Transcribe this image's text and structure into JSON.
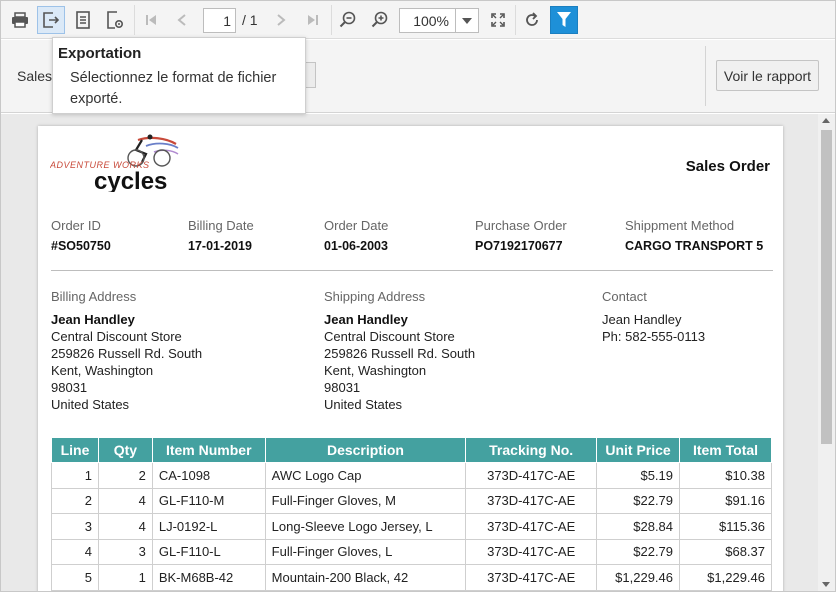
{
  "toolbar": {
    "page_current": "1",
    "page_total": "/ 1",
    "zoom": "100%"
  },
  "tooltip": {
    "title": "Exportation",
    "body": "Sélectionnez le format de fichier exporté."
  },
  "params": {
    "label": "Sales",
    "view_button": "Voir le rapport"
  },
  "colors": {
    "accent": "#1e90d8",
    "table_header": "#44a1a0"
  },
  "report": {
    "logo_text_top": "ADVENTURE WORKS",
    "logo_text_bottom": "cycles",
    "title": "Sales Order",
    "order_id_label": "Order ID",
    "order_id": "#SO50750",
    "billing_date_label": "Billing Date",
    "billing_date": "17-01-2019",
    "order_date_label": "Order Date",
    "order_date": "01-06-2003",
    "purchase_order_label": "Purchase Order",
    "purchase_order": "PO7192170677",
    "shipment_method_label": "Shippment Method",
    "shipment_method": "CARGO TRANSPORT 5",
    "billing_address_label": "Billing Address",
    "billing": {
      "name": "Jean Handley",
      "line1": "Central Discount Store",
      "line2": "259826 Russell Rd. South",
      "line3": "Kent, Washington",
      "line4": "98031",
      "line5": "United States"
    },
    "shipping_address_label": "Shipping Address",
    "shipping": {
      "name": "Jean Handley",
      "line1": "Central Discount Store",
      "line2": "259826 Russell Rd. South",
      "line3": "Kent, Washington",
      "line4": "98031",
      "line5": "United States"
    },
    "contact_label": "Contact",
    "contact": {
      "name": "Jean Handley",
      "phone": "Ph: 582-555-0113"
    },
    "table": {
      "headers": [
        "Line",
        "Qty",
        "Item Number",
        "Description",
        "Tracking No.",
        "Unit Price",
        "Item Total"
      ],
      "rows": [
        [
          "1",
          "2",
          "CA-1098",
          "AWC Logo Cap",
          "373D-417C-AE",
          "$5.19",
          "$10.38"
        ],
        [
          "2",
          "4",
          "GL-F110-M",
          "Full-Finger Gloves, M",
          "373D-417C-AE",
          "$22.79",
          "$91.16"
        ],
        [
          "3",
          "4",
          "LJ-0192-L",
          "Long-Sleeve Logo Jersey, L",
          "373D-417C-AE",
          "$28.84",
          "$115.36"
        ],
        [
          "4",
          "3",
          "GL-F110-L",
          "Full-Finger Gloves, L",
          "373D-417C-AE",
          "$22.79",
          "$68.37"
        ],
        [
          "5",
          "1",
          "BK-M68B-42",
          "Mountain-200 Black, 42",
          "373D-417C-AE",
          "$1,229.46",
          "$1,229.46"
        ]
      ]
    }
  }
}
